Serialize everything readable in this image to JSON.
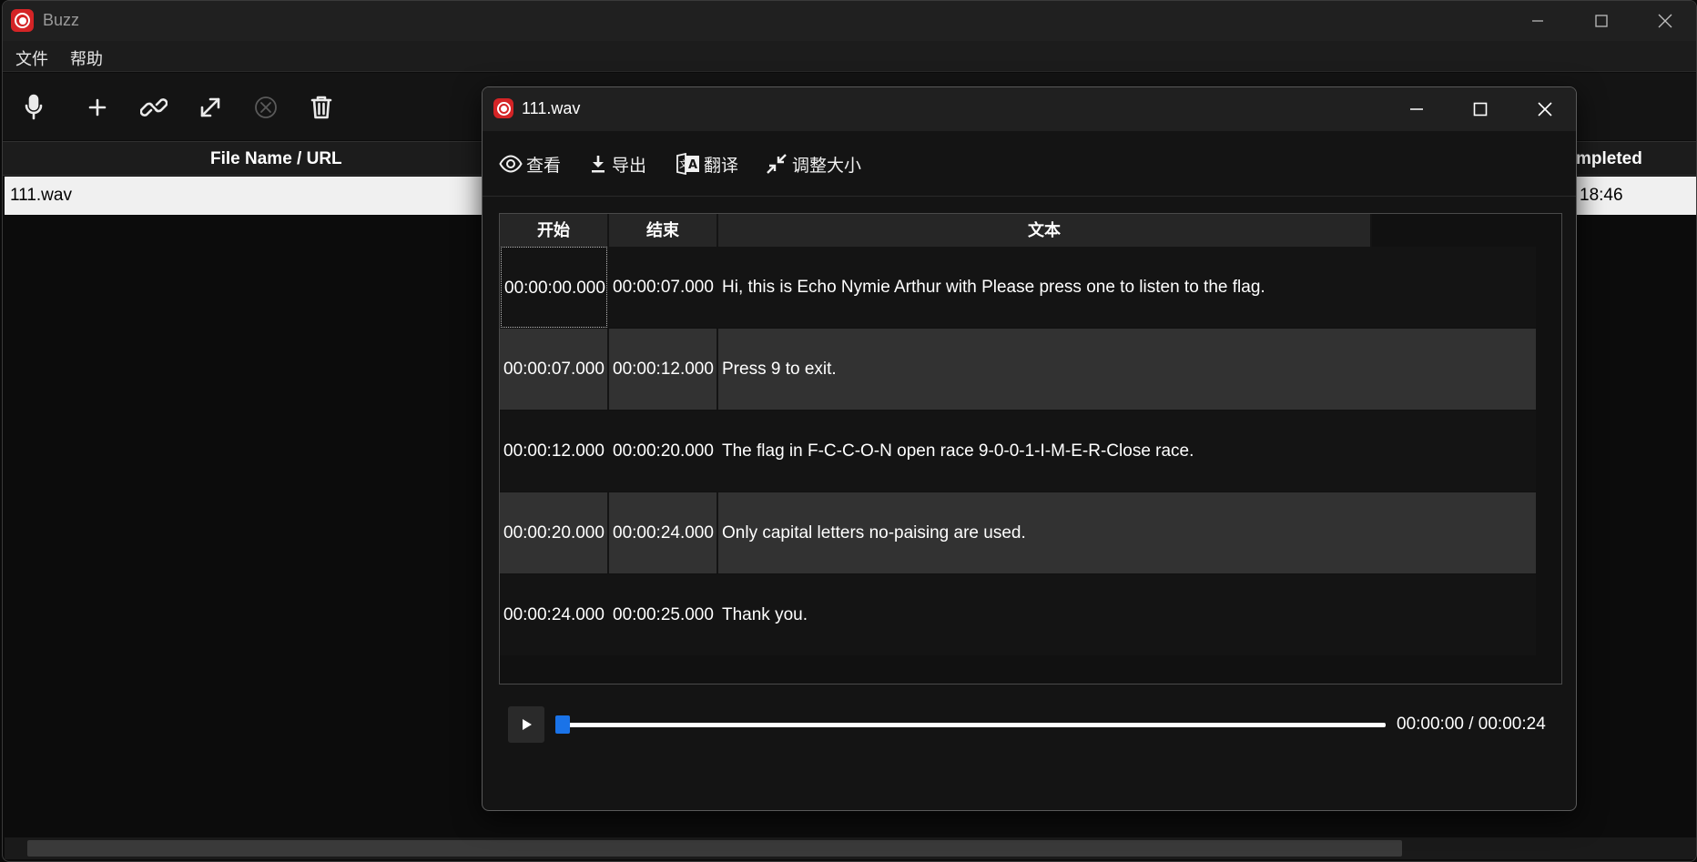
{
  "main_window": {
    "title": "Buzz",
    "menu": [
      "文件",
      "帮助"
    ],
    "table": {
      "columns": [
        "File Name / URL",
        "mpleted"
      ],
      "rows": [
        {
          "file_name": "111.wav",
          "completed": "18:46"
        }
      ]
    }
  },
  "dialog": {
    "title": "111.wav",
    "toolbar": {
      "view": "查看",
      "export": "导出",
      "translate": "翻译",
      "resize": "调整大小"
    },
    "columns": [
      "开始",
      "结束",
      "文本"
    ],
    "segments": [
      {
        "start": "00:00:00.000",
        "end": "00:00:07.000",
        "text": "Hi, this is Echo Nymie Arthur with Please press one to listen to the flag."
      },
      {
        "start": "00:00:07.000",
        "end": "00:00:12.000",
        "text": "Press 9 to exit."
      },
      {
        "start": "00:00:12.000",
        "end": "00:00:20.000",
        "text": "The flag in F-C-C-O-N open race 9-0-0-1-I-M-E-R-Close race."
      },
      {
        "start": "00:00:20.000",
        "end": "00:00:24.000",
        "text": "Only capital letters no-paising are used."
      },
      {
        "start": "00:00:24.000",
        "end": "00:00:25.000",
        "text": "Thank you."
      }
    ],
    "player": {
      "time": "00:00:00 / 00:00:24",
      "progress_fraction": 0.0
    }
  },
  "colors": {
    "logo_red": "#d42426",
    "seek_handle": "#1a73e8",
    "selected_row": "#f0f0f0"
  },
  "icons": [
    "microphone-icon",
    "plus-icon",
    "link-icon",
    "expand-icon",
    "cancel-circle-icon",
    "trash-icon",
    "eye-icon",
    "download-icon",
    "translate-icon",
    "shrink-icon",
    "play-icon"
  ]
}
